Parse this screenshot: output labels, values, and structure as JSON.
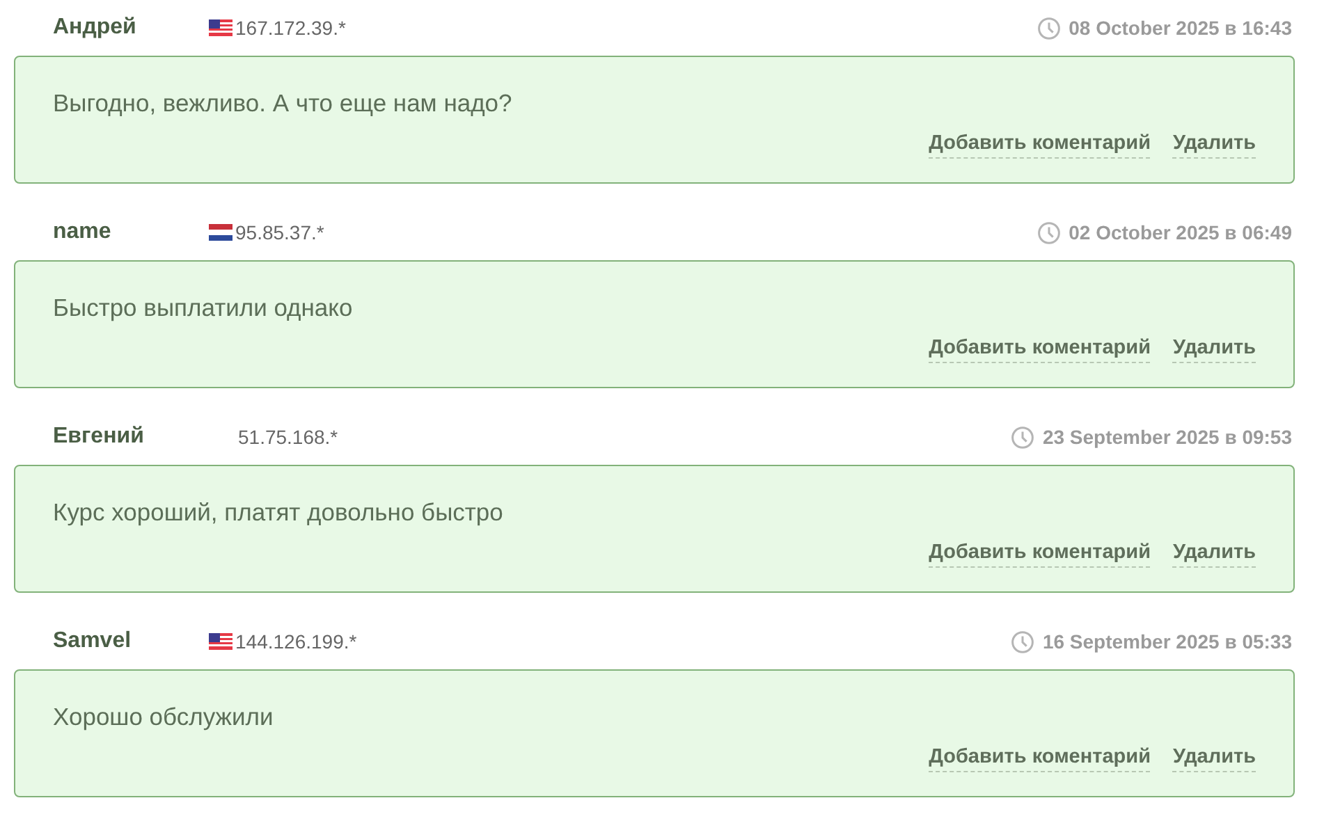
{
  "comments": [
    {
      "author": "Андрей",
      "kind": "us",
      "ip": "167.172.39.*",
      "date": "08 October 2025 в 16:43",
      "text": "Выгодно, вежливо. А что еще нам надо?",
      "actions": [
        "Добавить коментарий",
        "Удалить"
      ]
    },
    {
      "author": "name",
      "kind": "nl",
      "ip": "95.85.37.*",
      "date": "02 October 2025 в 06:49",
      "text": "Быстро выплатили однако",
      "actions": [
        "Добавить коментарий",
        "Удалить"
      ]
    },
    {
      "author": "Евгений",
      "kind": "plain",
      "ip": "51.75.168.*",
      "date": "23 September 2025 в 09:53",
      "text": "Курс хороший, платят довольно быстро",
      "actions": [
        "Добавить коментарий",
        "Удалить"
      ]
    },
    {
      "author": "Samvel",
      "kind": "us",
      "ip": "144.126.199.*",
      "date": "16 September 2025 в 05:33",
      "text": "Хорошо обслужили",
      "actions": [
        "Добавить коментарий",
        "Удалить"
      ]
    }
  ]
}
